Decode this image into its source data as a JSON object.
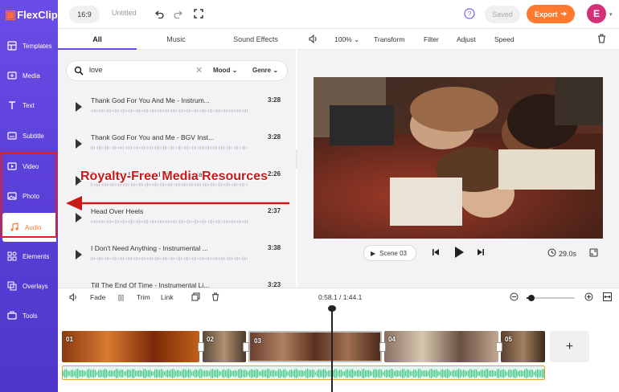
{
  "app": {
    "brand": "FlexClip",
    "ratio": "16:9",
    "title": "Untitled",
    "saved": "Saved",
    "export": "Export",
    "avatar_letter": "E"
  },
  "sidebar": {
    "items": [
      {
        "label": "Templates",
        "icon": "templates-icon"
      },
      {
        "label": "Media",
        "icon": "media-icon"
      },
      {
        "label": "Text",
        "icon": "text-icon"
      },
      {
        "label": "Subtitle",
        "icon": "subtitle-icon"
      },
      {
        "label": "Video",
        "icon": "video-icon"
      },
      {
        "label": "Photo",
        "icon": "photo-icon"
      },
      {
        "label": "Audio",
        "icon": "audio-icon",
        "active": true
      },
      {
        "label": "Elements",
        "icon": "elements-icon"
      },
      {
        "label": "Overlays",
        "icon": "overlays-icon"
      },
      {
        "label": "Tools",
        "icon": "tools-icon"
      }
    ]
  },
  "panel": {
    "tabs": [
      "All",
      "Music",
      "Sound Effects"
    ],
    "search": {
      "value": "love"
    },
    "filters": [
      "Mood",
      "Genre"
    ],
    "tracks": [
      {
        "name": "Thank God For You And Me - Instrum...",
        "duration": "3:28"
      },
      {
        "name": "Thank God For You and Me - BGV Inst...",
        "duration": "3:28"
      },
      {
        "name": "Better Than I Imagined - Instrumenta...",
        "duration": "2:26"
      },
      {
        "name": "Head Over Heels",
        "duration": "2:37"
      },
      {
        "name": "I Don't Need Anything - Instrumental ...",
        "duration": "3:38"
      },
      {
        "name": "Till The End Of Time - Instrumental Li...",
        "duration": "3:23"
      }
    ]
  },
  "annotation": {
    "text": "Royalty-Free Media Resources",
    "color": "#c81818"
  },
  "editor": {
    "zoom": "100%",
    "tools": [
      "Transform",
      "Filter",
      "Adjust",
      "Speed"
    ],
    "scene_label": "Scene 03",
    "duration": "29.0s"
  },
  "timeline": {
    "tools": [
      "Fade",
      "Trim",
      "Link"
    ],
    "time": "0:58.1 / 1:44.1",
    "zoom_level": 0.1,
    "clips": [
      "01",
      "02",
      "03",
      "04",
      "05"
    ]
  },
  "colors": {
    "accent": "#6a4de6",
    "brand_orange": "#ff7a2f",
    "audio_wave": "#3fc98a"
  }
}
